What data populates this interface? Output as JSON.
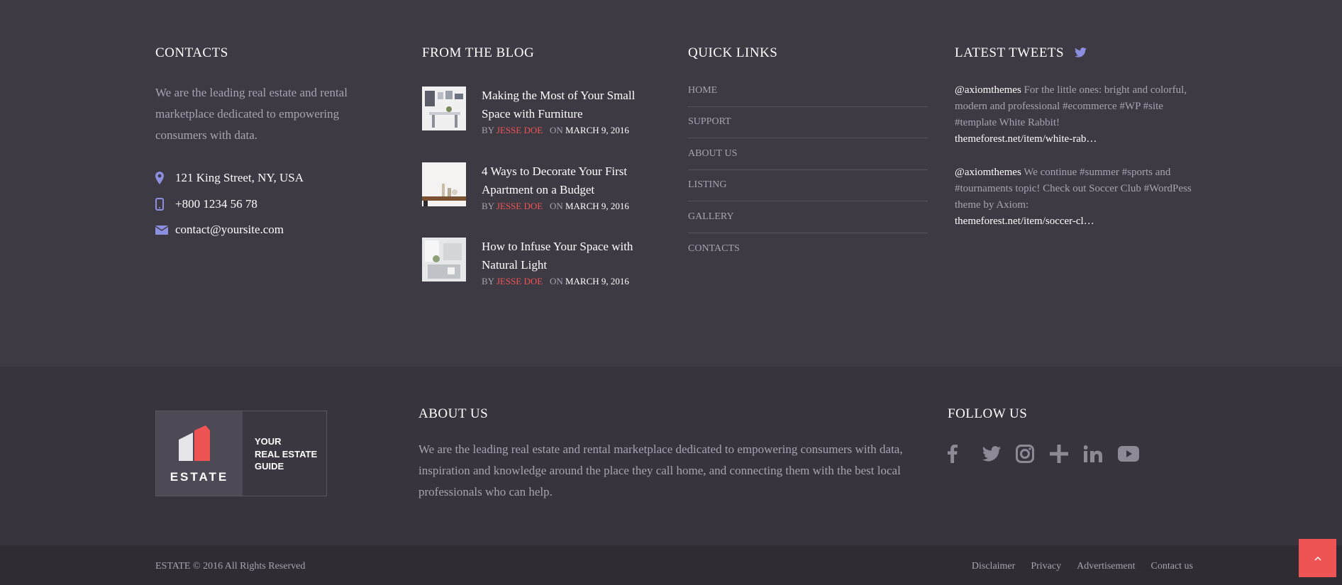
{
  "colors": {
    "accent_red": "#ef5455",
    "icon_purple": "#8c8fe0",
    "bg_top": "#3d3a44",
    "bg_middle": "#37343d",
    "bg_bottom": "#2f2c34"
  },
  "contacts": {
    "title": "CONTACTS",
    "description": "We are the leading real estate and rental marketplace dedicated to empowering consumers with data.",
    "address": "121 King Street, NY, USA",
    "phone": "+800 1234 56 78",
    "email": "contact@yoursite.com"
  },
  "blog": {
    "title": "FROM THE BLOG",
    "by_label": "BY",
    "on_label": "ON",
    "posts": [
      {
        "title": "Making the Most of Your Small Space with Furniture",
        "author": "JESSE DOE",
        "date": "MARCH 9, 2016"
      },
      {
        "title": "4 Ways to Decorate Your First Apartment on a Budget",
        "author": "JESSE DOE",
        "date": "MARCH 9, 2016"
      },
      {
        "title": "How to Infuse Your Space with Natural Light",
        "author": "JESSE DOE",
        "date": "MARCH 9, 2016"
      }
    ]
  },
  "quick_links": {
    "title": "QUICK LINKS",
    "items": [
      "HOME",
      "SUPPORT",
      "ABOUT US",
      "LISTING",
      "GALLERY",
      "CONTACTS"
    ]
  },
  "tweets": {
    "title": "LATEST TWEETS",
    "icon": "twitter-icon",
    "items": [
      {
        "handle": "@axiomthemes",
        "text": "For the little ones: bright and colorful, modern and professional #ecommerce #WP #site #template White Rabbit!",
        "link": "themeforest.net/item/white-rab…"
      },
      {
        "handle": "@axiomthemes",
        "text": "We continue #summer #sports and #tournaments topic! Check out Soccer Club #WordPess theme by Axiom:",
        "link": "themeforest.net/item/soccer-cl…"
      }
    ]
  },
  "logo": {
    "word": "ESTATE",
    "tagline_1": "YOUR",
    "tagline_2": "REAL ESTATE",
    "tagline_3": "GUIDE"
  },
  "about": {
    "title": "ABOUT US",
    "text": "We are the leading real estate and rental marketplace dedicated to empowering consumers with data, inspiration and knowledge around the place they call home, and connecting them with the best local professionals who can help."
  },
  "follow": {
    "title": "FOLLOW US",
    "icons": [
      "facebook-icon",
      "twitter-icon",
      "instagram-icon",
      "google-plus-icon",
      "linkedin-icon",
      "youtube-icon"
    ]
  },
  "footer": {
    "copyright": "ESTATE © 2016 All Rights Reserved",
    "links": [
      "Disclaimer",
      "Privacy",
      "Advertisement",
      "Contact us"
    ],
    "to_top_icon": "chevron-up-icon"
  }
}
